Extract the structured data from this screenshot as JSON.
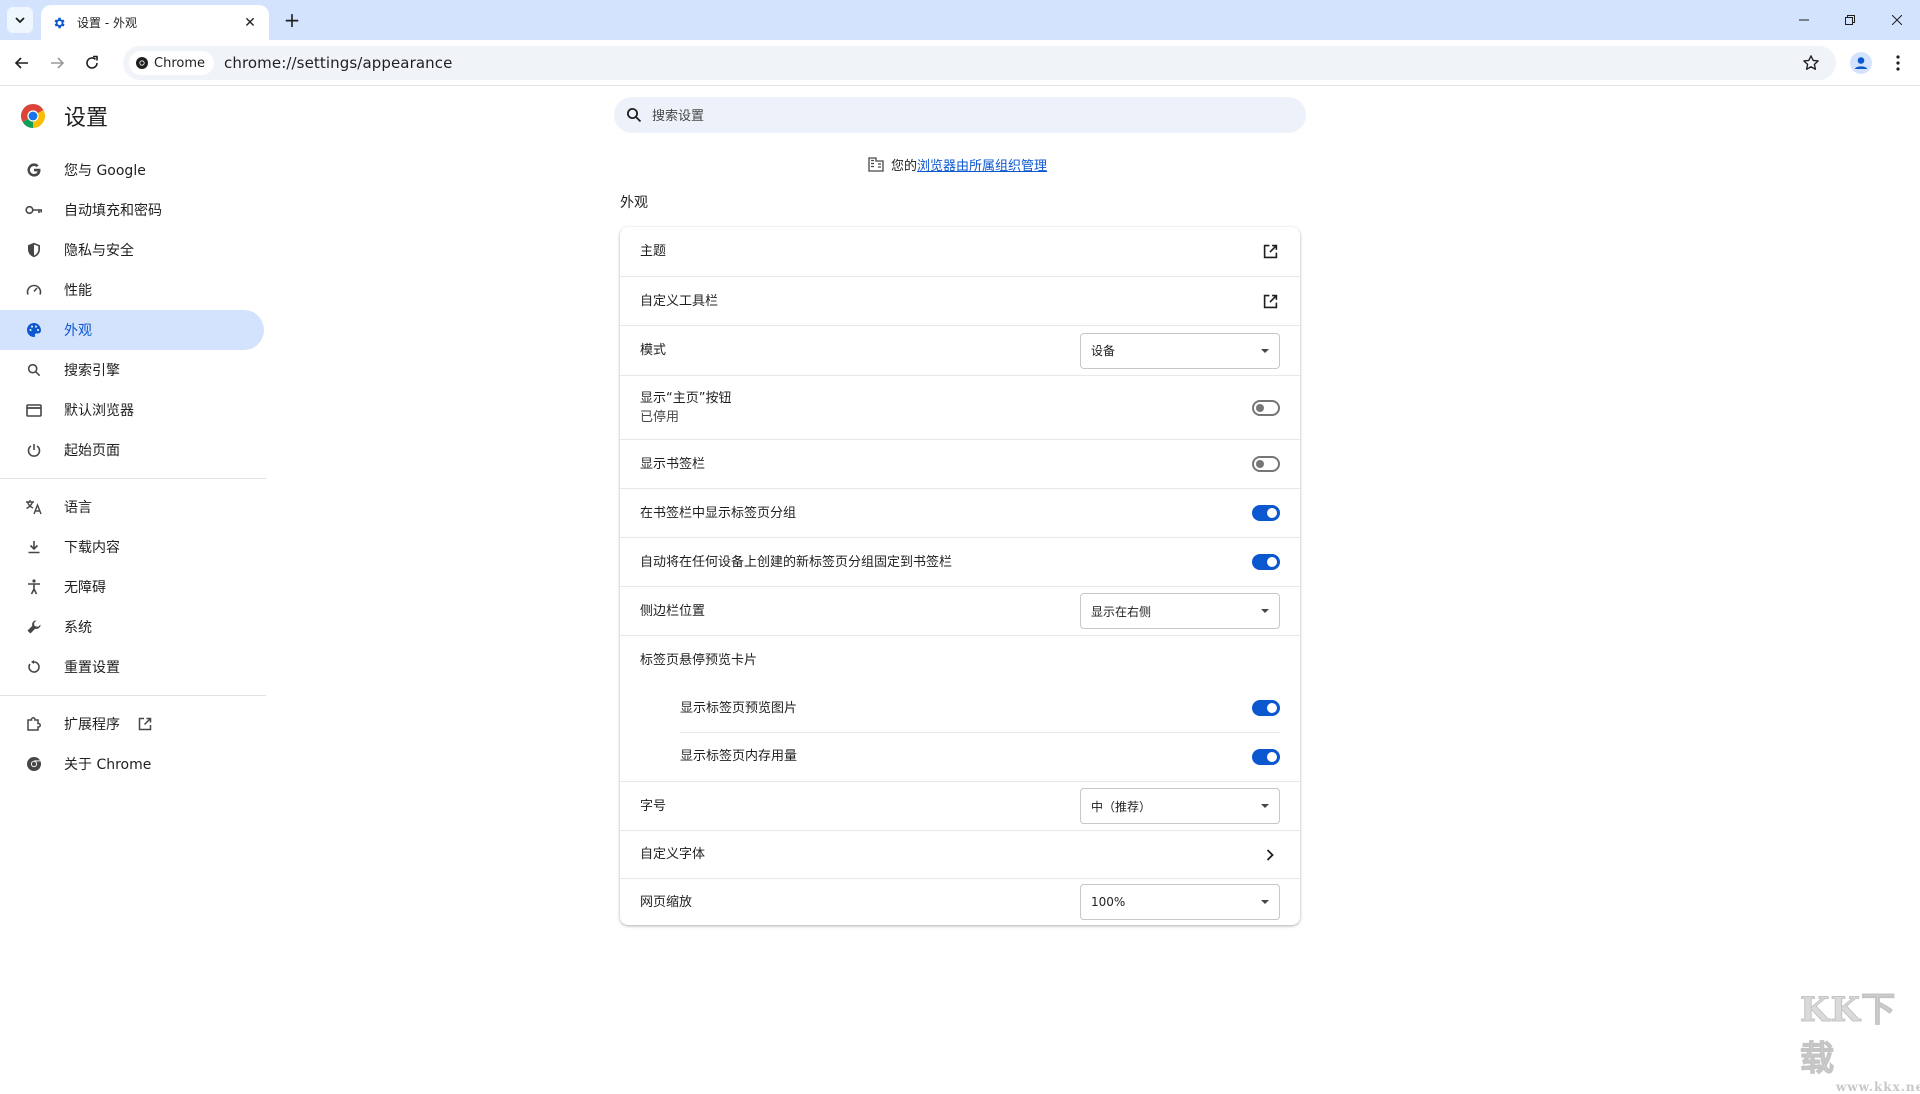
{
  "browser": {
    "tab_title": "设置 - 外观",
    "omnibox_chip": "Chrome",
    "url": "chrome://settings/appearance"
  },
  "header": {
    "title": "设置",
    "search_placeholder": "搜索设置"
  },
  "sidebar": {
    "items": [
      {
        "label": "您与 Google",
        "icon": "google-g-icon"
      },
      {
        "label": "自动填充和密码",
        "icon": "key-icon"
      },
      {
        "label": "隐私与安全",
        "icon": "shield-icon"
      },
      {
        "label": "性能",
        "icon": "speedometer-icon"
      },
      {
        "label": "外观",
        "icon": "palette-icon",
        "active": true
      },
      {
        "label": "搜索引擎",
        "icon": "search-icon"
      },
      {
        "label": "默认浏览器",
        "icon": "browser-window-icon"
      },
      {
        "label": "起始页面",
        "icon": "power-icon"
      },
      {
        "label": "语言",
        "icon": "translate-icon"
      },
      {
        "label": "下载内容",
        "icon": "download-icon"
      },
      {
        "label": "无障碍",
        "icon": "accessibility-icon"
      },
      {
        "label": "系统",
        "icon": "wrench-icon"
      },
      {
        "label": "重置设置",
        "icon": "reset-icon"
      },
      {
        "label": "扩展程序",
        "icon": "puzzle-icon"
      },
      {
        "label": "关于 Chrome",
        "icon": "chrome-icon"
      }
    ]
  },
  "main": {
    "managed_prefix": "您的",
    "managed_link": "浏览器由所属组织管理",
    "section_title": "外观",
    "rows": {
      "theme": "主题",
      "customize_toolbar": "自定义工具栏",
      "mode": "模式",
      "mode_value": "设备",
      "home_button": "显示“主页”按钮",
      "home_button_sub": "已停用",
      "bookmarks_bar": "显示书签栏",
      "tab_groups_in_bookmarks": "在书签栏中显示标签页分组",
      "auto_pin_groups": "自动将在任何设备上创建的新标签页分组固定到书签栏",
      "side_panel": "侧边栏位置",
      "side_panel_value": "显示在右侧",
      "hover_card": "标签页悬停预览卡片",
      "hover_preview_image": "显示标签页预览图片",
      "hover_memory": "显示标签页内存用量",
      "font_size": "字号",
      "font_size_value": "中（推荐）",
      "custom_fonts": "自定义字体",
      "page_zoom": "网页缩放",
      "page_zoom_value": "100%"
    },
    "toggles": {
      "home_button": false,
      "bookmarks_bar": false,
      "tab_groups_in_bookmarks": true,
      "auto_pin_groups": true,
      "hover_preview_image": true,
      "hover_memory": true
    }
  },
  "watermark": {
    "big": "KK下载",
    "small": "www.kkx.net"
  },
  "colors": {
    "accent": "#0b57d0",
    "tabstrip": "#d3e3fd",
    "active_nav": "#d3e3fd"
  }
}
